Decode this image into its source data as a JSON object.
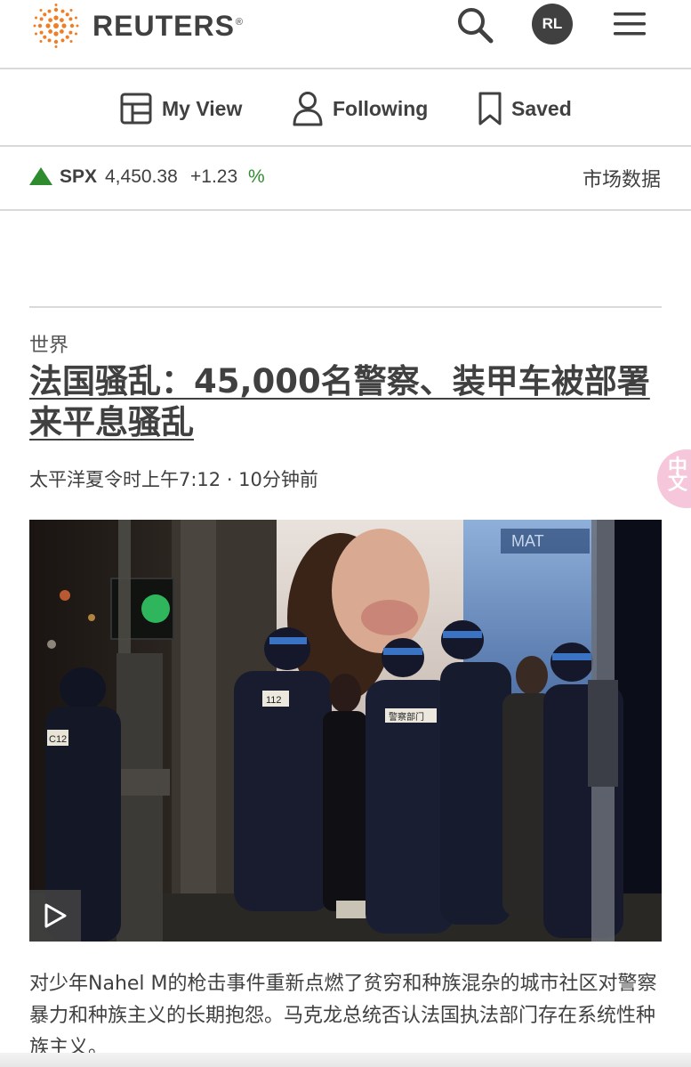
{
  "header": {
    "brand": "REUTERS",
    "trademark": "®",
    "user_initials": "RL"
  },
  "nav": {
    "items": [
      {
        "label": "My View",
        "icon": "layout-icon"
      },
      {
        "label": "Following",
        "icon": "person-icon"
      },
      {
        "label": "Saved",
        "icon": "bookmark-icon"
      }
    ]
  },
  "market": {
    "symbol": "SPX",
    "price": "4,450.38",
    "change": "+1.23",
    "percent_sign": "%",
    "direction": "up",
    "link_label": "市场数据",
    "up_color": "#2e8b2e"
  },
  "article": {
    "kicker": "世界",
    "headline": "法国骚乱：45,000名警察、装甲车被部署来平息骚乱",
    "timestamp": "太平洋夏令时上午7:12 · 10分钟前",
    "summary": "对少年Nahel M的枪击事件重新点燃了贫穷和种族混杂的城市社区对警察暴力和种族主义的长期抱怨。马克龙总统否认法国执法部门存在系统性种族主义。"
  },
  "photo": {
    "caption_labels": {
      "badge_112": "112",
      "police_label": "警察部门",
      "badge_c12": "C12",
      "billboard_text": "MAT"
    }
  },
  "colors": {
    "text": "#404040",
    "rule": "#d9d9d9",
    "brand_orange": "#f07e26"
  }
}
